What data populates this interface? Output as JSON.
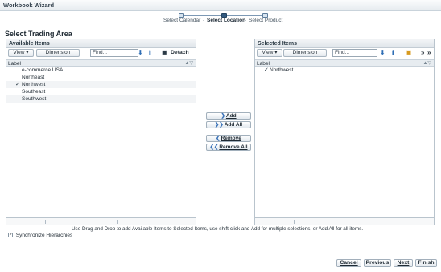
{
  "window": {
    "title": "Workbook Wizard"
  },
  "train": {
    "steps": [
      {
        "label": "Select Calendar",
        "active": false
      },
      {
        "label": "Select Location",
        "active": true
      },
      {
        "label": "Select Product",
        "active": false
      }
    ],
    "separator": "-"
  },
  "page": {
    "title": "Select Trading Area"
  },
  "available": {
    "header": "Available Items",
    "view_label": "View",
    "dimension_label": "Dimension",
    "find_placeholder": "Find...",
    "detach_label": "Detach",
    "column_label": "Label",
    "rows": [
      {
        "label": "e-commerce USA",
        "checked": false
      },
      {
        "label": "Northeast",
        "checked": false
      },
      {
        "label": "Northwest",
        "checked": true
      },
      {
        "label": "Southeast",
        "checked": false
      },
      {
        "label": "Southwest",
        "checked": false
      }
    ]
  },
  "selected": {
    "header": "Selected Items",
    "view_label": "View",
    "dimension_label": "Dimension",
    "find_placeholder": "Find...",
    "column_label": "Label",
    "rows": [
      {
        "label": "Northwest",
        "checked": true
      }
    ]
  },
  "shuttle": {
    "add": "Add",
    "add_all": "Add All",
    "remove": "Remove",
    "remove_all": "Remove All"
  },
  "hint_text": "Use Drag and Drop to add Available Items to Selected Items, use shift-click and Add for multiple selections, or Add All for all items.",
  "sync": {
    "label": "Synchronize Hierarchies",
    "checked": true
  },
  "buttons": {
    "cancel": "Cancel",
    "previous": "Previous",
    "next": "Next",
    "finish": "Finish"
  },
  "icons": {
    "dropdown": "▾",
    "down_arrow": "⬇",
    "up_arrow": "⬆",
    "detach": "▣",
    "expand": "»",
    "checkmark": "✓",
    "sort": "▲▽"
  },
  "colors": {
    "accent": "#32597f",
    "toolbar_icon": "#2f6eb5"
  }
}
